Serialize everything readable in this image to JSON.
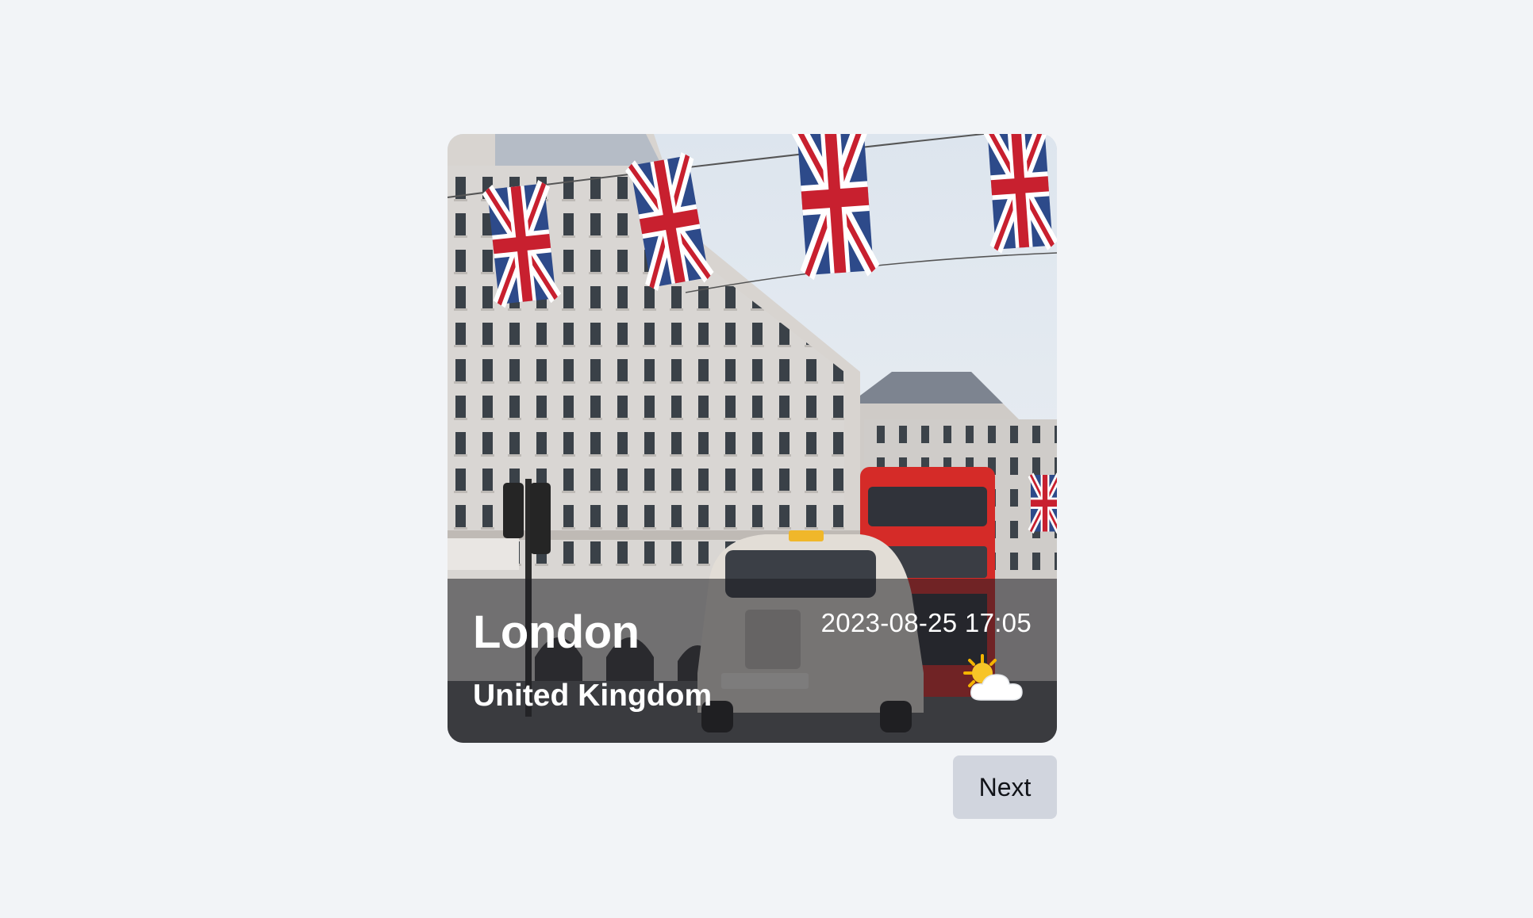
{
  "card": {
    "city": "London",
    "country": "United Kingdom",
    "datetime": "2023-08-25 17:05",
    "weather_icon": "sun-behind-cloud-icon",
    "photo_subject": "Street scene with Union Jack flags, a black-cab taxi and a red double-decker bus"
  },
  "actions": {
    "next_label": "Next"
  },
  "colors": {
    "page_background": "#f2f4f7",
    "button_background": "#d1d5de",
    "bus_red": "#d52b28",
    "flag_blue": "#2d4a8a",
    "flag_red": "#c8202f"
  }
}
